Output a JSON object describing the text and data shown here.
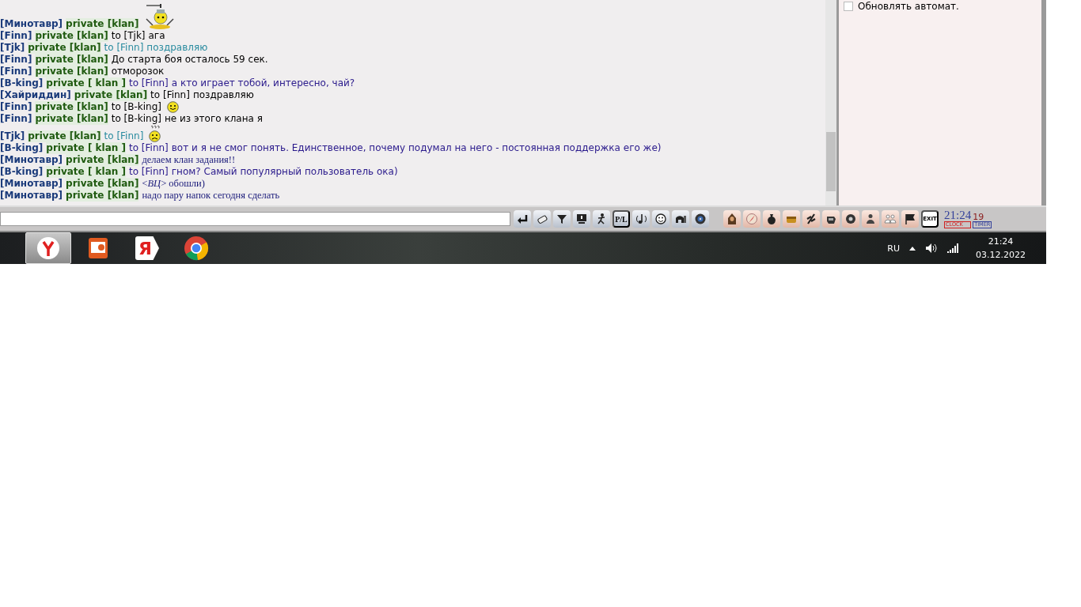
{
  "chat": {
    "messages": [
      {
        "sender": "[Минотавр]",
        "channel": "private [klan]",
        "kind": "warrior"
      },
      {
        "sender": "[Finn]",
        "channel": "private [klan]",
        "to": "to [Tjk]",
        "text": "ага",
        "color": "#000000",
        "kind": "sans"
      },
      {
        "sender": "[Tjk]",
        "channel": "private [klan]",
        "to": "to [Finn]",
        "text": "поздравляю",
        "color": "#2b8ca0",
        "kind": "sans"
      },
      {
        "sender": "[Finn]",
        "channel": "private [klan]",
        "text": "До старта боя осталось 59 сек.",
        "color": "#000000",
        "kind": "sans"
      },
      {
        "sender": "[Finn]",
        "channel": "private [klan]",
        "text": "отморозок",
        "color": "#000000",
        "kind": "sans"
      },
      {
        "sender": "[B-king]",
        "channel": "private [ klan ]",
        "to": "to [Finn]",
        "text": "а кто играет тобой, интересно, чай?",
        "color": "#2a1a8c",
        "kind": "sans"
      },
      {
        "sender": "[Хайриддин]",
        "channel": "private [klan]",
        "to": "to [Finn]",
        "text": "поздравляю",
        "color": "#000000",
        "kind": "sans"
      },
      {
        "sender": "[Finn]",
        "channel": "private [klan]",
        "to": "to [B-king]",
        "color": "#000000",
        "kind": "smile"
      },
      {
        "sender": "[Finn]",
        "channel": "private [klan]",
        "to": "to [B-king]",
        "text": "не из этого клана я",
        "color": "#000000",
        "kind": "sans"
      },
      {
        "sender": "[Tjk]",
        "channel": "private [klan]",
        "to": "to [Finn]",
        "color": "#2b8ca0",
        "kind": "confused"
      },
      {
        "sender": "[B-king]",
        "channel": "private [ klan ]",
        "to": "to [Finn]",
        "text": "вот и я не смог понять. Единственное, почему подумал на него - постоянная поддержка его же)",
        "color": "#2a1a8c",
        "kind": "sans"
      },
      {
        "sender": "[Минотавр]",
        "channel": "private [klan]",
        "text": "делаем клан задания!!",
        "color": "#1a1a7a",
        "kind": "serif"
      },
      {
        "sender": "[B-king]",
        "channel": "private [ klan ]",
        "to": "to [Finn]",
        "text": "гном? Самый популярный пользователь ока)",
        "color": "#2a1a8c",
        "kind": "sans"
      },
      {
        "sender": "[Минотавр]",
        "channel": "private [klan]",
        "text": "<*ВЦ*> обошли)",
        "color": "#1a1a7a",
        "kind": "serif"
      },
      {
        "sender": "[Минотавр]",
        "channel": "private [klan]",
        "text": "надо пару напок сегодня сделать",
        "color": "#1a1a7a",
        "kind": "serif"
      }
    ]
  },
  "side_panel": {
    "auto_refresh": {
      "label": "Обновлять автомат.",
      "checked": false
    }
  },
  "toolbar": {
    "pl_label": "P/L",
    "exit_label": "EXIT",
    "clock": {
      "time": "21:24",
      "seconds": "19",
      "clock_label": "CLOCK",
      "timer_label": "TIMER"
    }
  },
  "taskbar": {
    "yandex_letter": "Я",
    "language": "RU",
    "time": "21:24",
    "date": "03.12.2022"
  }
}
